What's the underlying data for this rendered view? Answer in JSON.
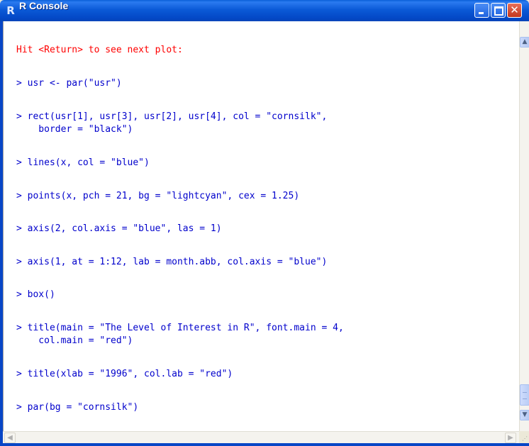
{
  "window": {
    "title": "R Console",
    "app_icon": "r-logo-icon",
    "controls": {
      "minimize_icon": "minimize-icon",
      "maximize_icon": "maximize-icon",
      "close_icon": "close-icon"
    }
  },
  "console": {
    "notice": "Hit <Return> to see next plot:",
    "lines": [
      "> usr <- par(\"usr\")",
      "> rect(usr[1], usr[3], usr[2], usr[4], col = \"cornsilk\",",
      "    border = \"black\")",
      "> lines(x, col = \"blue\")",
      "> points(x, pch = 21, bg = \"lightcyan\", cex = 1.25)",
      "> axis(2, col.axis = \"blue\", las = 1)",
      "> axis(1, at = 1:12, lab = month.abb, col.axis = \"blue\")",
      "> box()",
      "> title(main = \"The Level of Interest in R\", font.main = 4,",
      "    col.main = \"red\")",
      "> title(xlab = \"1996\", col.lab = \"red\")",
      "> par(bg = \"cornsilk\")"
    ]
  },
  "colors": {
    "command_text": "#0000cc",
    "notice_text": "#ff0000",
    "titlebar": "#0a5fd8"
  }
}
